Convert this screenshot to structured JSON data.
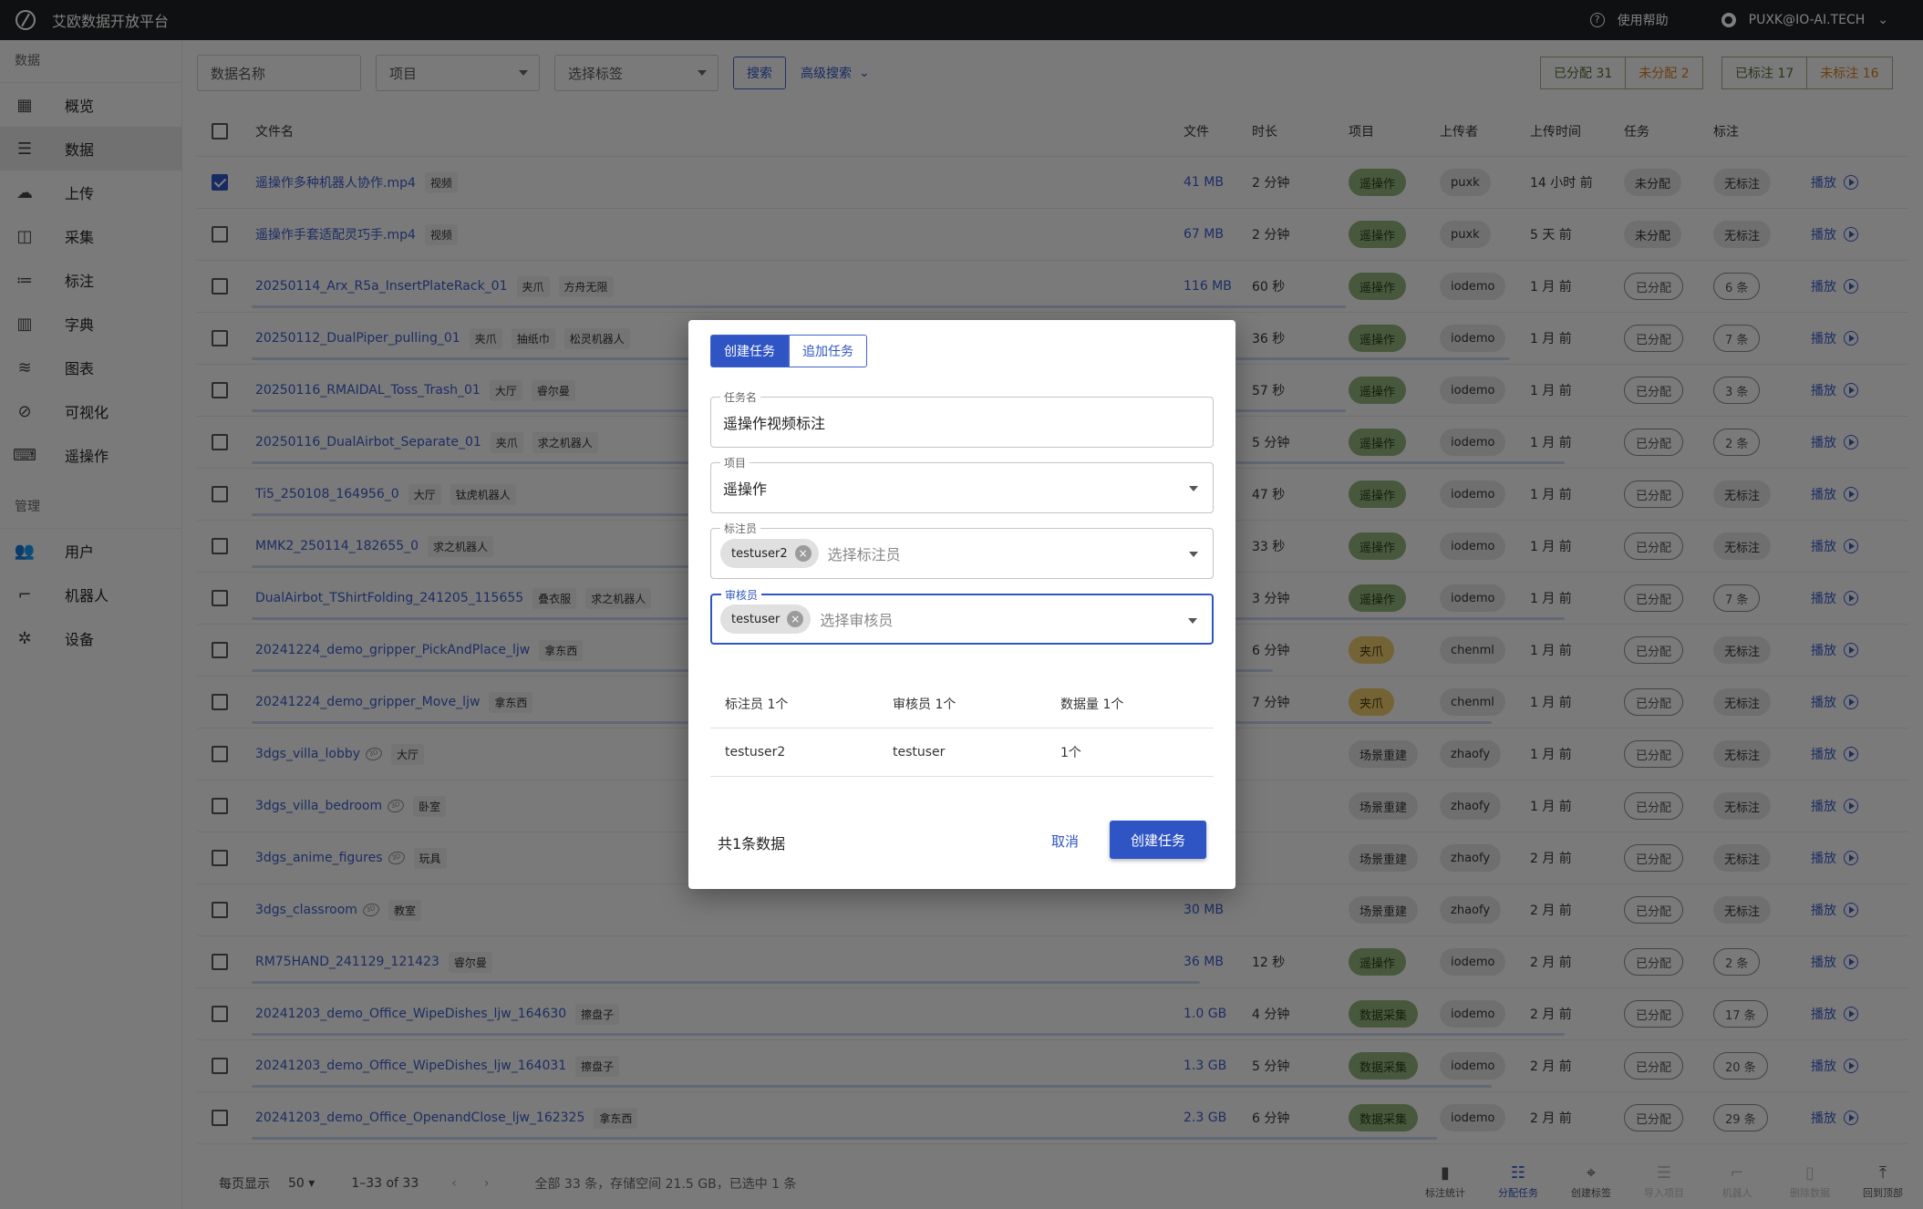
{
  "app": {
    "title": "艾欧数据开放平台",
    "help": "使用帮助",
    "user": "PUXK@IO-AI.TECH"
  },
  "sidebar": {
    "section_data": "数据",
    "section_manage": "管理",
    "data_items": [
      {
        "label": "概览",
        "icon": "dashboard-icon"
      },
      {
        "label": "数据",
        "icon": "list-icon"
      },
      {
        "label": "上传",
        "icon": "cloud-upload-icon"
      },
      {
        "label": "采集",
        "icon": "camera-icon"
      },
      {
        "label": "标注",
        "icon": "checklist-icon"
      },
      {
        "label": "字典",
        "icon": "book-icon"
      },
      {
        "label": "图表",
        "icon": "chart-icon"
      },
      {
        "label": "可视化",
        "icon": "visualization-icon"
      },
      {
        "label": "遥操作",
        "icon": "gamepad-icon"
      }
    ],
    "manage_items": [
      {
        "label": "用户",
        "icon": "users-icon"
      },
      {
        "label": "机器人",
        "icon": "robot-arm-icon"
      },
      {
        "label": "设备",
        "icon": "devices-icon"
      }
    ]
  },
  "filters": {
    "name_placeholder": "数据名称",
    "project_placeholder": "项目",
    "tag_placeholder": "选择标签",
    "search": "搜索",
    "advanced": "高级搜索"
  },
  "stats": {
    "assigned": "已分配 31",
    "unassigned": "未分配 2",
    "labeled": "已标注 17",
    "unlabeled": "未标注 16"
  },
  "table": {
    "headers": [
      "文件名",
      "文件",
      "时长",
      "项目",
      "上传者",
      "上传时间",
      "任务",
      "标注"
    ],
    "play": "播放",
    "rows": [
      {
        "name": "遥操作多种机器人协作.mp4",
        "tags": [
          "视频"
        ],
        "size": "41 MB",
        "dur": "2 分钟",
        "proj": "遥操作",
        "pc": "green",
        "up": "puxk",
        "time": "14 小时 前",
        "task": "未分配",
        "label": "无标注",
        "checked": true
      },
      {
        "name": "遥操作手套适配灵巧手.mp4",
        "tags": [
          "视频"
        ],
        "size": "67 MB",
        "dur": "2 分钟",
        "proj": "遥操作",
        "pc": "green",
        "up": "puxk",
        "time": "5 天 前",
        "task": "未分配",
        "label": "无标注",
        "checked": false
      },
      {
        "name": "20250114_Arx_R5a_InsertPlateRack_01",
        "tags": [
          "夹爪",
          "方舟无限"
        ],
        "size": "116 MB",
        "dur": "60 秒",
        "proj": "遥操作",
        "pc": "green",
        "up": "iodemo",
        "time": "1 月 前",
        "task": "已分配",
        "label": "6 条",
        "checked": false
      },
      {
        "name": "20250112_DualPiper_pulling_01",
        "tags": [
          "夹爪",
          "抽纸巾",
          "松灵机器人"
        ],
        "size": "",
        "dur": "36 秒",
        "proj": "遥操作",
        "pc": "green",
        "up": "iodemo",
        "time": "1 月 前",
        "task": "已分配",
        "label": "7 条",
        "checked": false
      },
      {
        "name": "20250116_RMAIDAL_Toss_Trash_01",
        "tags": [
          "大厅",
          "睿尔曼"
        ],
        "size": "",
        "dur": "57 秒",
        "proj": "遥操作",
        "pc": "green",
        "up": "iodemo",
        "time": "1 月 前",
        "task": "已分配",
        "label": "3 条",
        "checked": false
      },
      {
        "name": "20250116_DualAirbot_Separate_01",
        "tags": [
          "夹爪",
          "求之机器人"
        ],
        "size": "",
        "dur": "5 分钟",
        "proj": "遥操作",
        "pc": "green",
        "up": "iodemo",
        "time": "1 月 前",
        "task": "已分配",
        "label": "2 条",
        "checked": false
      },
      {
        "name": "Ti5_250108_164956_0",
        "tags": [
          "大厅",
          "钛虎机器人"
        ],
        "size": "",
        "dur": "47 秒",
        "proj": "遥操作",
        "pc": "green",
        "up": "iodemo",
        "time": "1 月 前",
        "task": "已分配",
        "label": "无标注",
        "checked": false
      },
      {
        "name": "MMK2_250114_182655_0",
        "tags": [
          "求之机器人"
        ],
        "size": "",
        "dur": "33 秒",
        "proj": "遥操作",
        "pc": "green",
        "up": "iodemo",
        "time": "1 月 前",
        "task": "已分配",
        "label": "无标注",
        "checked": false
      },
      {
        "name": "DualAirbot_TShirtFolding_241205_115655",
        "tags": [
          "叠衣服",
          "求之机器人"
        ],
        "size": "",
        "dur": "3 分钟",
        "proj": "遥操作",
        "pc": "green",
        "up": "iodemo",
        "time": "1 月 前",
        "task": "已分配",
        "label": "7 条",
        "checked": false
      },
      {
        "name": "20241224_demo_gripper_PickAndPlace_ljw",
        "tags": [
          "拿东西"
        ],
        "size": "",
        "dur": "6 分钟",
        "proj": "夹爪",
        "pc": "yellow",
        "up": "chenml",
        "time": "1 月 前",
        "task": "已分配",
        "label": "无标注",
        "checked": false
      },
      {
        "name": "20241224_demo_gripper_Move_ljw",
        "tags": [
          "拿东西"
        ],
        "size": "",
        "dur": "7 分钟",
        "proj": "夹爪",
        "pc": "yellow",
        "up": "chenml",
        "time": "1 月 前",
        "task": "已分配",
        "label": "无标注",
        "checked": false
      },
      {
        "name": "3dgs_villa_lobby",
        "tags": [
          "大厅"
        ],
        "size": "",
        "dur": "",
        "proj": "场景重建",
        "pc": "gray",
        "up": "zhaofy",
        "time": "1 月 前",
        "task": "已分配",
        "label": "无标注",
        "checked": false
      },
      {
        "name": "3dgs_villa_bedroom",
        "tags": [
          "卧室"
        ],
        "size": "",
        "dur": "",
        "proj": "场景重建",
        "pc": "gray",
        "up": "zhaofy",
        "time": "1 月 前",
        "task": "已分配",
        "label": "无标注",
        "checked": false
      },
      {
        "name": "3dgs_anime_figures",
        "tags": [
          "玩具"
        ],
        "size": "",
        "dur": "",
        "proj": "场景重建",
        "pc": "gray",
        "up": "zhaofy",
        "time": "2 月 前",
        "task": "已分配",
        "label": "无标注",
        "checked": false
      },
      {
        "name": "3dgs_classroom",
        "tags": [
          "教室"
        ],
        "size": "30 MB",
        "dur": "",
        "proj": "场景重建",
        "pc": "gray",
        "up": "zhaofy",
        "time": "2 月 前",
        "task": "已分配",
        "label": "无标注",
        "checked": false
      },
      {
        "name": "RM75HAND_241129_121423",
        "tags": [
          "睿尔曼"
        ],
        "size": "36 MB",
        "dur": "12 秒",
        "proj": "遥操作",
        "pc": "green",
        "up": "iodemo",
        "time": "2 月 前",
        "task": "已分配",
        "label": "2 条",
        "checked": false
      },
      {
        "name": "20241203_demo_Office_WipeDishes_ljw_164630",
        "tags": [
          "擦盘子"
        ],
        "size": "1.0 GB",
        "dur": "4 分钟",
        "proj": "数据采集",
        "pc": "green",
        "up": "iodemo",
        "time": "2 月 前",
        "task": "已分配",
        "label": "17 条",
        "checked": false
      },
      {
        "name": "20241203_demo_Office_WipeDishes_ljw_164031",
        "tags": [
          "擦盘子"
        ],
        "size": "1.3 GB",
        "dur": "5 分钟",
        "proj": "数据采集",
        "pc": "green",
        "up": "iodemo",
        "time": "2 月 前",
        "task": "已分配",
        "label": "20 条",
        "checked": false
      },
      {
        "name": "20241203_demo_Office_OpenandClose_ljw_162325",
        "tags": [
          "拿东西"
        ],
        "size": "2.3 GB",
        "dur": "6 分钟",
        "proj": "数据采集",
        "pc": "green",
        "up": "iodemo",
        "time": "2 月 前",
        "task": "已分配",
        "label": "29 条",
        "checked": false
      }
    ]
  },
  "footer": {
    "per_page_label": "每页显示",
    "per_page": "50",
    "range": "1–33 of 33",
    "summary": "全部 33 条，存储空间 21.5 GB，已选中 1 条",
    "tools": [
      {
        "label": "标注统计",
        "icon": "bar-chart-icon",
        "state": "normal"
      },
      {
        "label": "分配任务",
        "icon": "task-list-icon",
        "state": "active"
      },
      {
        "label": "创建标签",
        "icon": "tag-icon",
        "state": "normal"
      },
      {
        "label": "导入项目",
        "icon": "import-icon",
        "state": "disabled"
      },
      {
        "label": "机器人",
        "icon": "robot-icon",
        "state": "disabled"
      },
      {
        "label": "删除数据",
        "icon": "trash-icon",
        "state": "disabled"
      },
      {
        "label": "回到顶部",
        "icon": "arrow-up-icon",
        "state": "normal"
      }
    ]
  },
  "modal": {
    "tab_create": "创建任务",
    "tab_append": "追加任务",
    "task_name_label": "任务名",
    "task_name_value": "遥操作视频标注",
    "project_label": "项目",
    "project_value": "遥操作",
    "annotator_label": "标注员",
    "annotator_chip": "testuser2",
    "annotator_placeholder": "选择标注员",
    "reviewer_label": "审核员",
    "reviewer_chip": "testuser",
    "reviewer_placeholder": "选择审核员",
    "summary_headers": [
      "标注员 1个",
      "审核员 1个",
      "数据量 1个"
    ],
    "summary_row": [
      "testuser2",
      "testuser",
      "1个"
    ],
    "total": "共1条数据",
    "cancel": "取消",
    "create": "创建任务"
  }
}
